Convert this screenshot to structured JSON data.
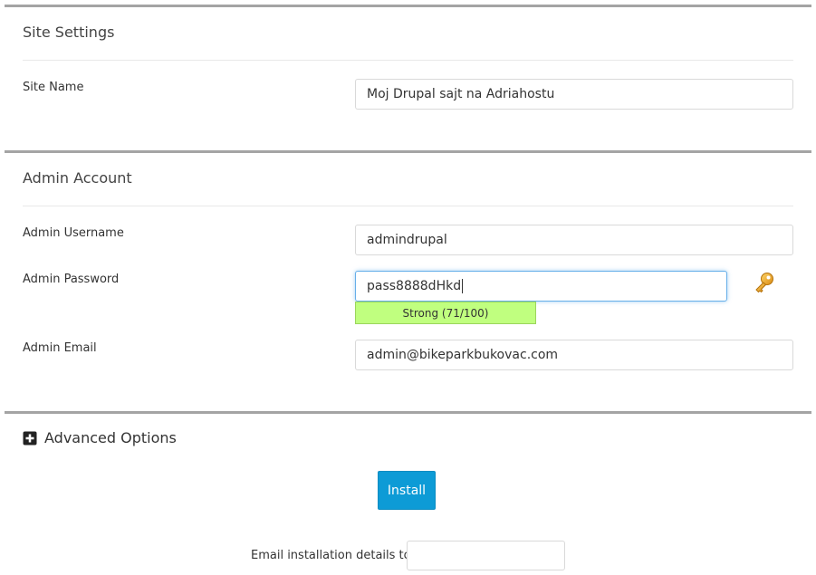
{
  "site_settings": {
    "title": "Site Settings",
    "site_name_label": "Site Name",
    "site_name_value": "Moj Drupal sajt na Adriahostu"
  },
  "admin_account": {
    "title": "Admin Account",
    "username_label": "Admin Username",
    "username_value": "admindrupal",
    "password_label": "Admin Password",
    "password_value": "pass8888dHkd",
    "strength_text": "Strong (71/100)",
    "strength_score": 71,
    "strength_color": "#c0ff7f",
    "email_label": "Admin Email",
    "email_value": "admin@bikeparkbukovac.com",
    "generate_password_icon": "key-icon"
  },
  "advanced": {
    "label": "Advanced Options",
    "icon": "plus-square-icon"
  },
  "actions": {
    "install_label": "Install",
    "install_color": "#0d9bd6",
    "email_details_label": "Email installation details to :",
    "email_details_value": ""
  },
  "colors": {
    "section_bar": "#a4a4a4",
    "focus_border": "#66afe9"
  }
}
